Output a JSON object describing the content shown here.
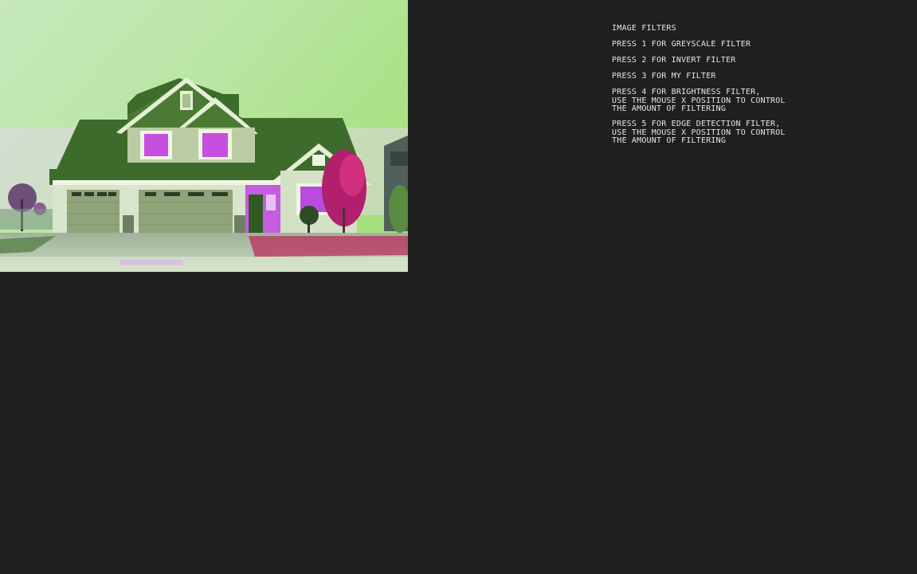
{
  "canvas": {
    "image_subject": "house-photo"
  },
  "panel": {
    "title": "IMAGE FILTERS",
    "items": [
      {
        "lines": [
          "PRESS 1 FOR GREYSCALE FILTER"
        ]
      },
      {
        "lines": [
          "PRESS 2 FOR INVERT FILTER"
        ]
      },
      {
        "lines": [
          "PRESS 3 FOR MY FILTER"
        ]
      },
      {
        "lines": [
          "PRESS 4 FOR BRIGHTNESS FILTER,",
          "USE THE MOUSE X POSITION TO CONTROL",
          "THE AMOUNT OF FILTERING"
        ]
      },
      {
        "lines": [
          "PRESS 5 FOR EDGE DETECTION FILTER,",
          "USE THE MOUSE X POSITION TO CONTROL",
          "THE AMOUNT OF FILTERING"
        ]
      }
    ]
  },
  "colors": {
    "background": "#1f1f1f",
    "text": "#e6e6e6"
  }
}
